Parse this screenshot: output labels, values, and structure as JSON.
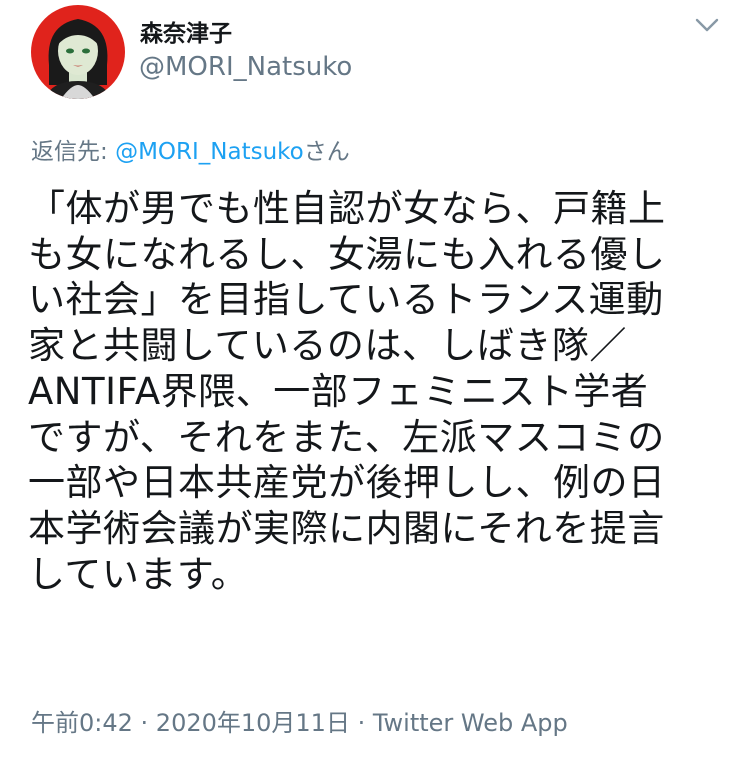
{
  "user": {
    "display_name": "森奈津子",
    "handle": "@MORI_Natsuko"
  },
  "icons": {
    "more": "chevron-down-icon"
  },
  "reply": {
    "prefix": "返信先: ",
    "mention": "@MORI_Natsuko",
    "suffix": "さん"
  },
  "tweet": {
    "text": "「体が男でも性自認が女なら、戸籍上\nも女になれるし、女湯にも入れる優し\nい社会」を目指しているトランス運動\n家と共闘しているのは、しばき隊／\nANTIFA界隈、一部フェミニスト学者\nですが、それをまた、左派マスコミの\n一部や日本共産党が後押しし、例の日\n本学術会議が実際に内閣にそれを提言\nしています。"
  },
  "meta": {
    "time": "午前0:42",
    "separator": " · ",
    "date": "2020年10月11日",
    "source": "Twitter Web App"
  },
  "colors": {
    "avatar_bg": "#e0231c",
    "secondary_text": "#657786",
    "link": "#1da1f2",
    "primary_text": "#14171a"
  }
}
